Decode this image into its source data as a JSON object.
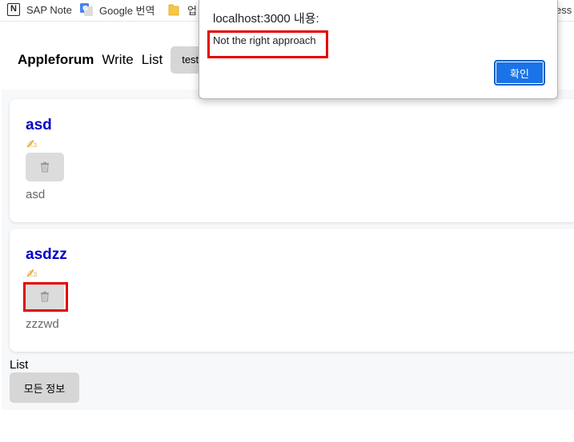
{
  "bookmarks": [
    {
      "label": "SAP Note",
      "icon": "notion-icon"
    },
    {
      "label": "Google 번역",
      "icon": "google-translate-icon"
    },
    {
      "label": "업",
      "icon": "folder-icon"
    },
    {
      "label": "ess",
      "icon": ""
    }
  ],
  "navbar": {
    "brand": "Appleforum",
    "write_link": "Write",
    "list_link": "List",
    "user_button": "test"
  },
  "posts": [
    {
      "title": "asd",
      "edit_icon": "✍",
      "delete_icon": "trash-icon",
      "content": "asd"
    },
    {
      "title": "asdzz",
      "edit_icon": "✍",
      "delete_icon": "trash-icon",
      "content": "zzzwd"
    }
  ],
  "footer": {
    "label": "List",
    "all_info_button": "모든 정보"
  },
  "dialog": {
    "title": "localhost:3000 내용:",
    "message": "Not the right approach",
    "ok_button": "확인"
  },
  "colors": {
    "post_title": "#0000c8",
    "dialog_ok": "#1a73e8",
    "highlight": "#e60000"
  }
}
